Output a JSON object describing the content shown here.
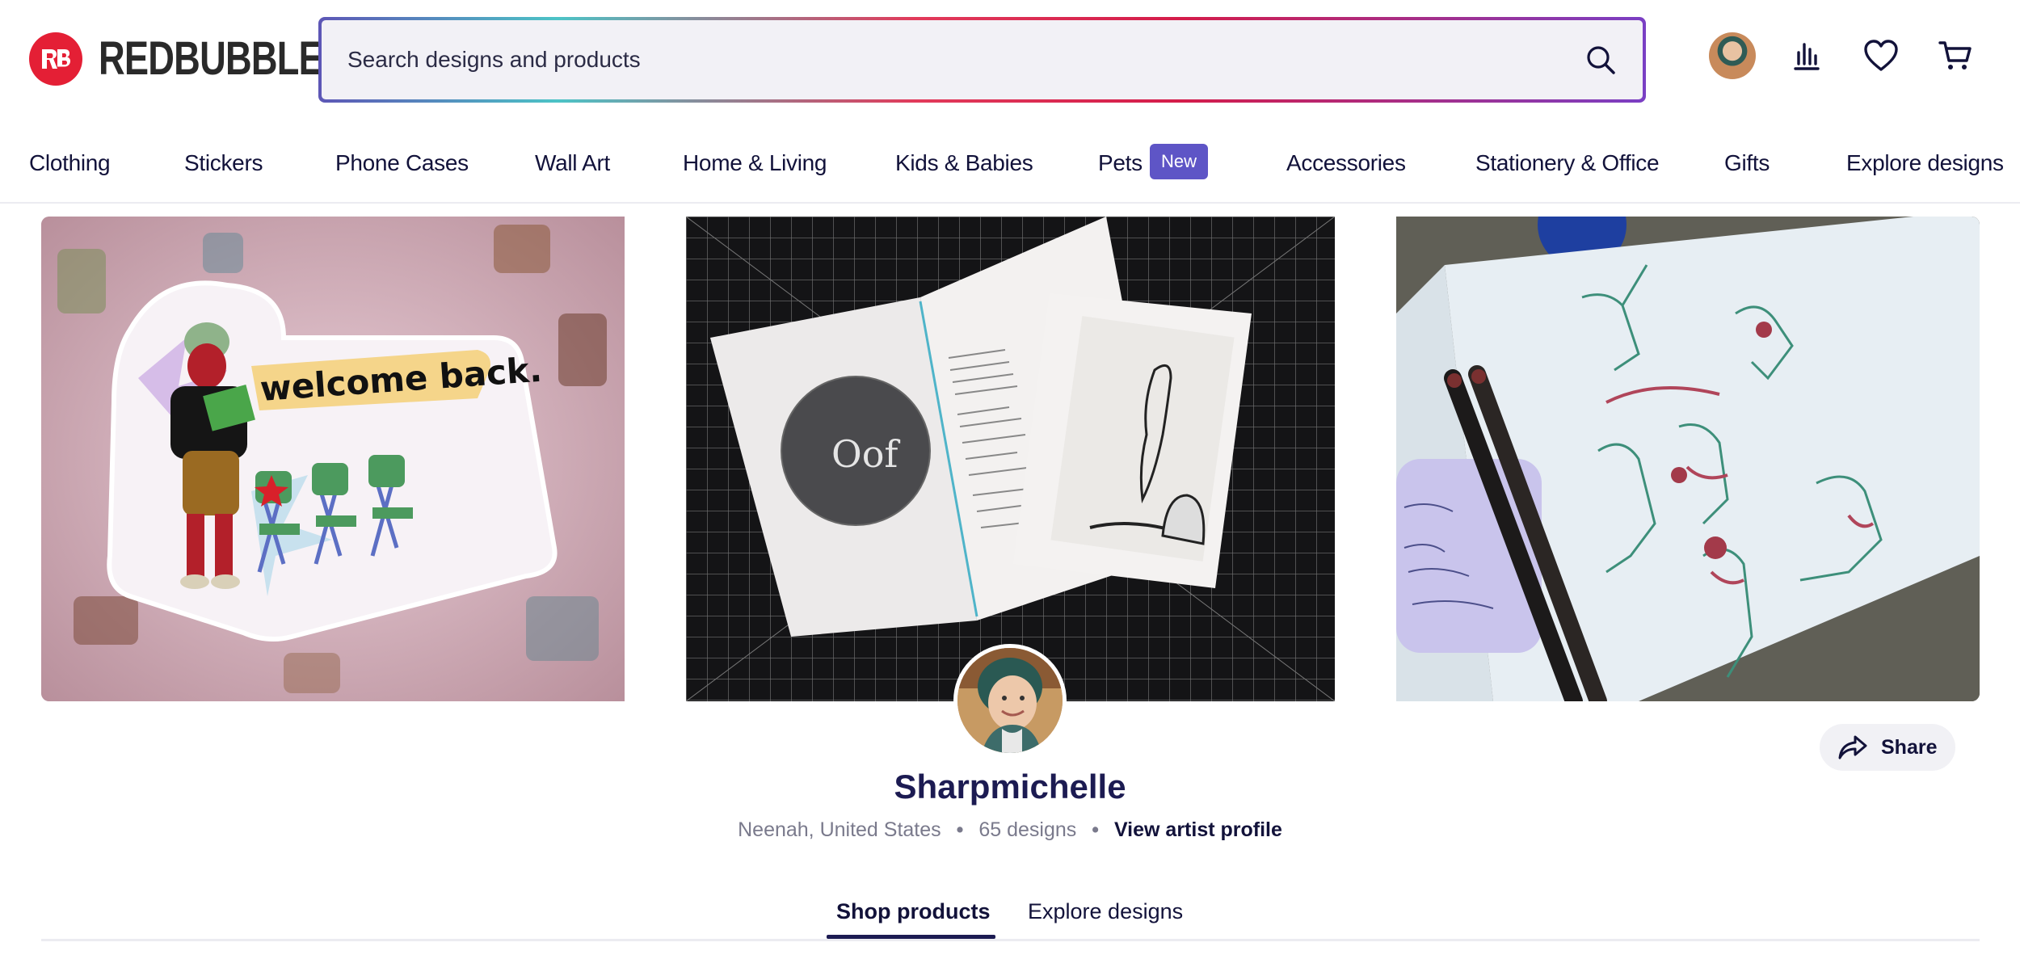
{
  "brand": {
    "name": "REDBUBBLE",
    "color": "#e41f35",
    "mark_icon": "redbubble-logo-icon"
  },
  "search": {
    "placeholder": "Search designs and products",
    "icon": "search-icon"
  },
  "header_icons": [
    "user-avatar",
    "analytics-icon",
    "heart-icon",
    "cart-icon"
  ],
  "nav": {
    "items": [
      {
        "label": "Clothing"
      },
      {
        "label": "Stickers"
      },
      {
        "label": "Phone Cases"
      },
      {
        "label": "Wall Art"
      },
      {
        "label": "Home & Living"
      },
      {
        "label": "Kids & Babies"
      },
      {
        "label": "Pets"
      },
      {
        "label": "Accessories"
      },
      {
        "label": "Stationery & Office"
      },
      {
        "label": "Gifts"
      },
      {
        "label": "Explore designs"
      }
    ],
    "new_badge": "New",
    "badge_color": "#5e55c6"
  },
  "banner": {
    "sticker_text": "welcome back.",
    "zine_word": "Oof"
  },
  "artist": {
    "name": "Sharpmichelle",
    "location": "Neenah, United States",
    "design_count": "65 designs",
    "profile_link": "View artist profile",
    "share_label": "Share"
  },
  "tabs": [
    {
      "label": "Shop products",
      "active": true
    },
    {
      "label": "Explore designs",
      "active": false
    }
  ],
  "colors": {
    "text": "#12123a",
    "accent": "#1c1b52"
  }
}
